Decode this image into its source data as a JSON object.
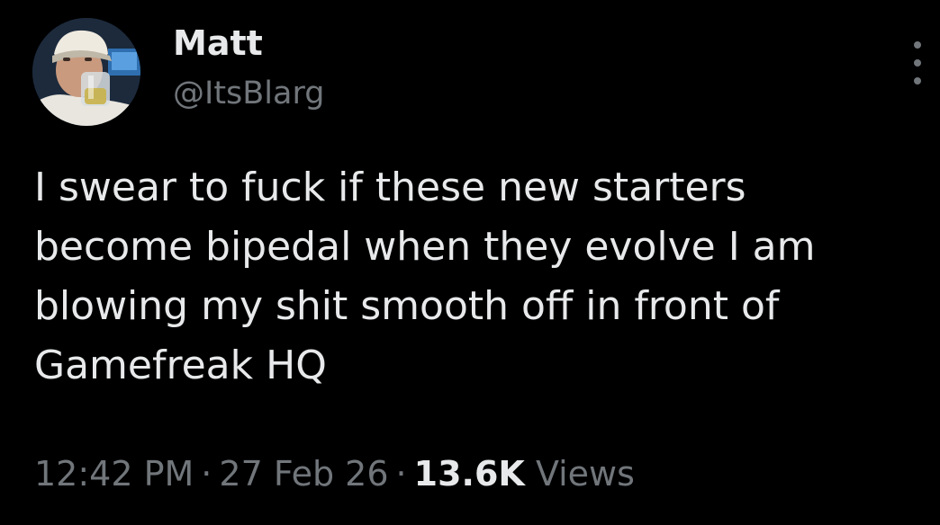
{
  "author": {
    "name": "Matt",
    "handle": "@ItsBlarg",
    "avatar_icon": "user-avatar-photo"
  },
  "more_icon": "more-options-icon",
  "tweet": {
    "lines": [
      "I swear to fuck if these new starters",
      "become bipedal when they evolve I am",
      "blowing my shit smooth off in front of",
      "Gamefreak HQ"
    ]
  },
  "meta": {
    "time": "12:42 PM",
    "separator": "·",
    "date": "27 Feb 26",
    "views_count": "13.6K",
    "views_label": "Views"
  },
  "colors": {
    "background": "#000000",
    "primary_text": "#e7e9ea",
    "secondary_text": "#71767b"
  }
}
